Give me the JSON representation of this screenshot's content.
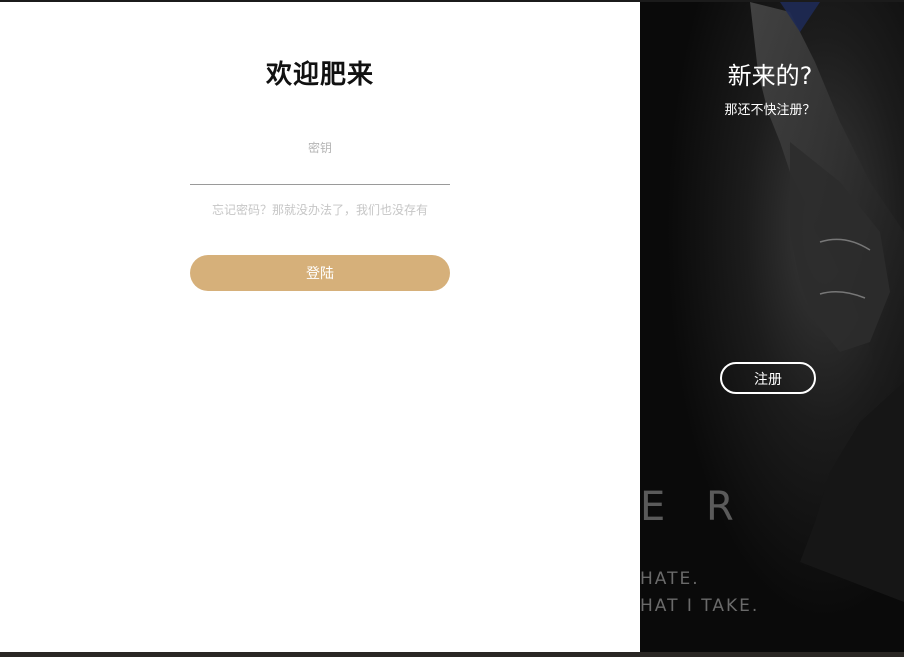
{
  "login": {
    "title": "欢迎肥来",
    "password_label": "密钥",
    "password_value": "",
    "forgot_text": "忘记密码？那就没办法了，我们也没存有",
    "submit_label": "登陆"
  },
  "signup": {
    "title": "新来的?",
    "subtitle": "那还不快注册？",
    "button_label": "注册"
  },
  "background_art": {
    "text_large": "E R",
    "text_line1": "HATE.",
    "text_line2": "HAT I TAKE."
  },
  "colors": {
    "accent": "#d6b07a",
    "login_bg": "#ffffff",
    "signup_bg": "#0c0c0c"
  }
}
